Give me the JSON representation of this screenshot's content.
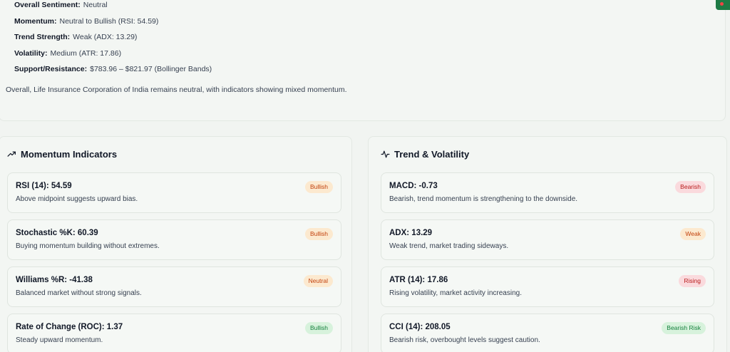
{
  "summary": {
    "rows": [
      {
        "key": "Overall Sentiment:",
        "value": "Neutral"
      },
      {
        "key": "Momentum:",
        "value": "Neutral to Bullish (RSI: 54.59)"
      },
      {
        "key": "Trend Strength:",
        "value": "Weak (ADX: 13.29)"
      },
      {
        "key": "Volatility:",
        "value": "Medium (ATR: 17.86)"
      },
      {
        "key": "Support/Resistance:",
        "value": "$783.96 – $821.97 (Bollinger Bands)"
      }
    ],
    "note": "Overall, Life Insurance Corporation of India remains neutral, with indicators showing mixed momentum."
  },
  "momentum": {
    "title": "Momentum Indicators",
    "icon": "trending-up-icon",
    "items": [
      {
        "title": "RSI (14): 54.59",
        "desc": "Above midpoint suggests upward bias.",
        "badge": "Bullish",
        "badge_color": "#c2410c"
      },
      {
        "title": "Stochastic %K: 60.39",
        "desc": "Buying momentum building without extremes.",
        "badge": "Bullish",
        "badge_color": "#c2410c"
      },
      {
        "title": "Williams %R: -41.38",
        "desc": "Balanced market without strong signals.",
        "badge": "Neutral",
        "badge_color": "#c2410c"
      },
      {
        "title": "Rate of Change (ROC): 1.37",
        "desc": "Steady upward momentum.",
        "badge": "Bullish",
        "badge_color": "#15803d"
      }
    ]
  },
  "trend": {
    "title": "Trend & Volatility",
    "icon": "activity-icon",
    "items": [
      {
        "title": "MACD: -0.73",
        "desc": "Bearish, trend momentum is strengthening to the downside.",
        "badge": "Bearish",
        "badge_color": "#b91c1c"
      },
      {
        "title": "ADX: 13.29",
        "desc": "Weak trend, market trading sideways.",
        "badge": "Weak",
        "badge_color": "#c2410c"
      },
      {
        "title": "ATR (14): 17.86",
        "desc": "Rising volatility, market activity increasing.",
        "badge": "Rising",
        "badge_color": "#b91c1c"
      },
      {
        "title": "CCI (14): 208.05",
        "desc": "Bearish risk, overbought levels suggest caution.",
        "badge": "Bearish Risk",
        "badge_color": "#15803d"
      }
    ]
  }
}
